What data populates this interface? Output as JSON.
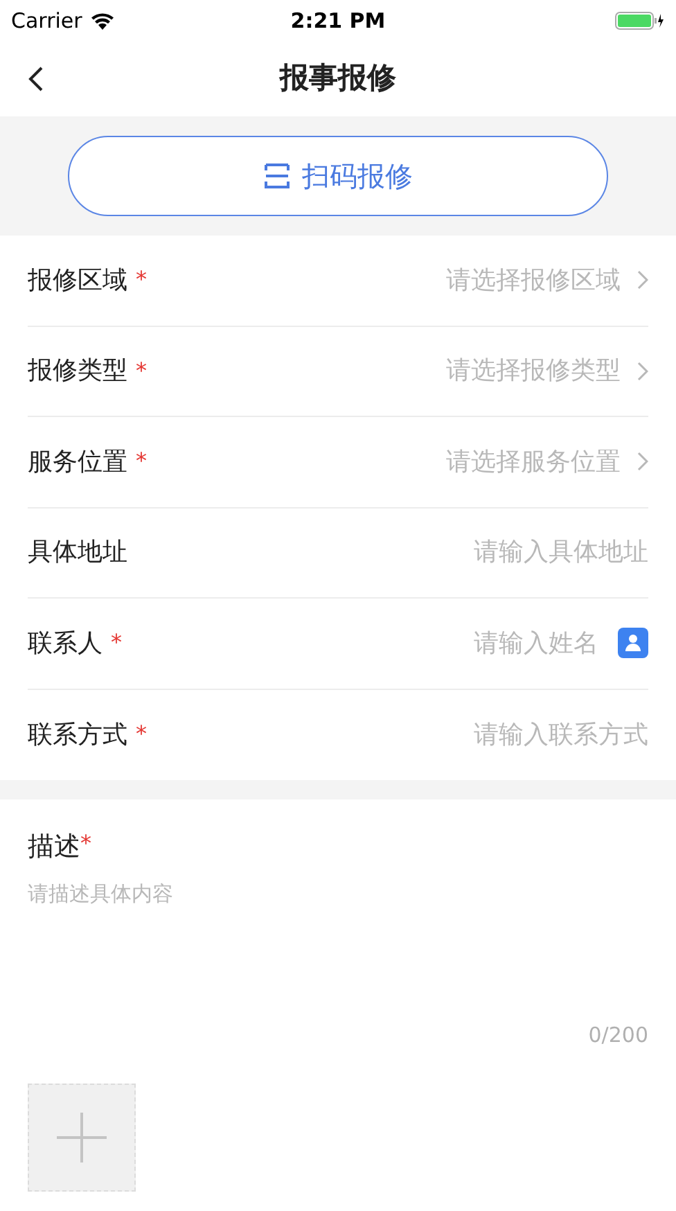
{
  "status_bar": {
    "carrier": "Carrier",
    "time": "2:21 PM"
  },
  "nav": {
    "title": "报事报修"
  },
  "scan_button": {
    "label": "扫码报修"
  },
  "fields": [
    {
      "label": "报修区域",
      "mark": "*",
      "kind": "select",
      "placeholder": "请选择报修区域"
    },
    {
      "label": "报修类型",
      "mark": "*",
      "kind": "select",
      "placeholder": "请选择报修类型"
    },
    {
      "label": "服务位置",
      "mark": "*",
      "kind": "select",
      "placeholder": "请选择服务位置"
    },
    {
      "label": "具体地址",
      "kind": "input",
      "placeholder": "请输入具体地址"
    },
    {
      "label": "联系人",
      "mark": "*",
      "kind": "contact",
      "placeholder": "请输入姓名"
    },
    {
      "label": "联系方式",
      "mark": "*",
      "kind": "input",
      "placeholder": "请输入联系方式"
    }
  ],
  "description": {
    "label": "描述",
    "mark": "*",
    "placeholder": "请描述具体内容",
    "counter": "0/200"
  }
}
